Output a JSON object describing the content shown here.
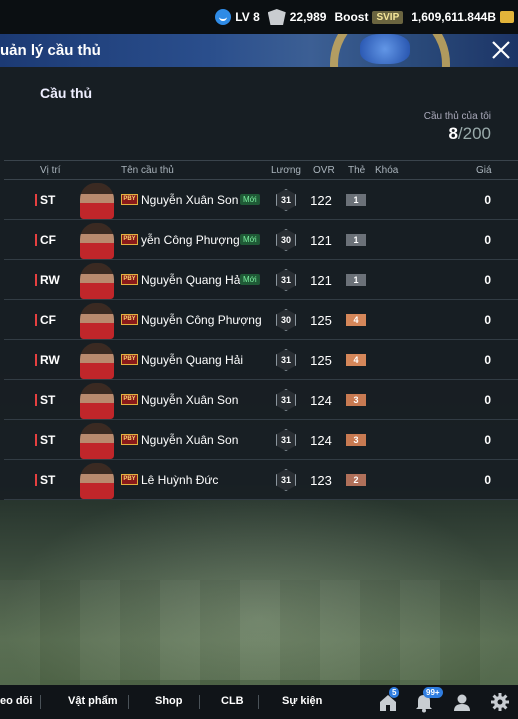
{
  "topbar": {
    "level": "LV 8",
    "coins": "22,989",
    "boost_label": "Boost",
    "svip_label": "SVIP",
    "bp": "1,609,611.844B"
  },
  "header": {
    "title": "uản lý cầu thủ"
  },
  "panel": {
    "section_title": "Cầu thủ",
    "my_players_label": "Cầu thủ của tôi",
    "count": "8",
    "max": "/200"
  },
  "table": {
    "headers": {
      "position": "Vị trí",
      "name": "Tên cầu thủ",
      "salary": "Lương",
      "ovr": "OVR",
      "card": "Thẻ",
      "lock": "Khóa",
      "price": "Giá"
    },
    "season_badge": "PBY",
    "new_badge": "Mới",
    "rows": [
      {
        "pos": "ST",
        "name": "Nguyễn Xuân Son",
        "new": true,
        "salary": "31",
        "ovr": "122",
        "grade": "1",
        "price": "0"
      },
      {
        "pos": "CF",
        "name": "yễn Công Phượng",
        "new": true,
        "salary": "30",
        "ovr": "121",
        "grade": "1",
        "price": "0"
      },
      {
        "pos": "RW",
        "name": "Nguyễn Quang Hả",
        "new": true,
        "salary": "31",
        "ovr": "121",
        "grade": "1",
        "price": "0"
      },
      {
        "pos": "CF",
        "name": "Nguyễn Công Phượng",
        "new": false,
        "salary": "30",
        "ovr": "125",
        "grade": "4",
        "price": "0"
      },
      {
        "pos": "RW",
        "name": "Nguyễn Quang Hải",
        "new": false,
        "salary": "31",
        "ovr": "125",
        "grade": "4",
        "price": "0"
      },
      {
        "pos": "ST",
        "name": "Nguyễn Xuân Son",
        "new": false,
        "salary": "31",
        "ovr": "124",
        "grade": "3",
        "price": "0"
      },
      {
        "pos": "ST",
        "name": "Nguyễn Xuân Son",
        "new": false,
        "salary": "31",
        "ovr": "124",
        "grade": "3",
        "price": "0"
      },
      {
        "pos": "ST",
        "name": "Lê Huỳnh Đức",
        "new": false,
        "salary": "31",
        "ovr": "123",
        "grade": "2",
        "price": "0"
      }
    ]
  },
  "grade_colors": {
    "1": "#6b7178",
    "2": "#b0705a",
    "3": "#c87a52",
    "4": "#d5875a"
  },
  "bottomnav": {
    "tabs": [
      "eo dõi",
      "Vật phẩm",
      "Shop",
      "CLB",
      "Sự kiện"
    ],
    "home_badge": "5",
    "bell_badge": "99+"
  }
}
